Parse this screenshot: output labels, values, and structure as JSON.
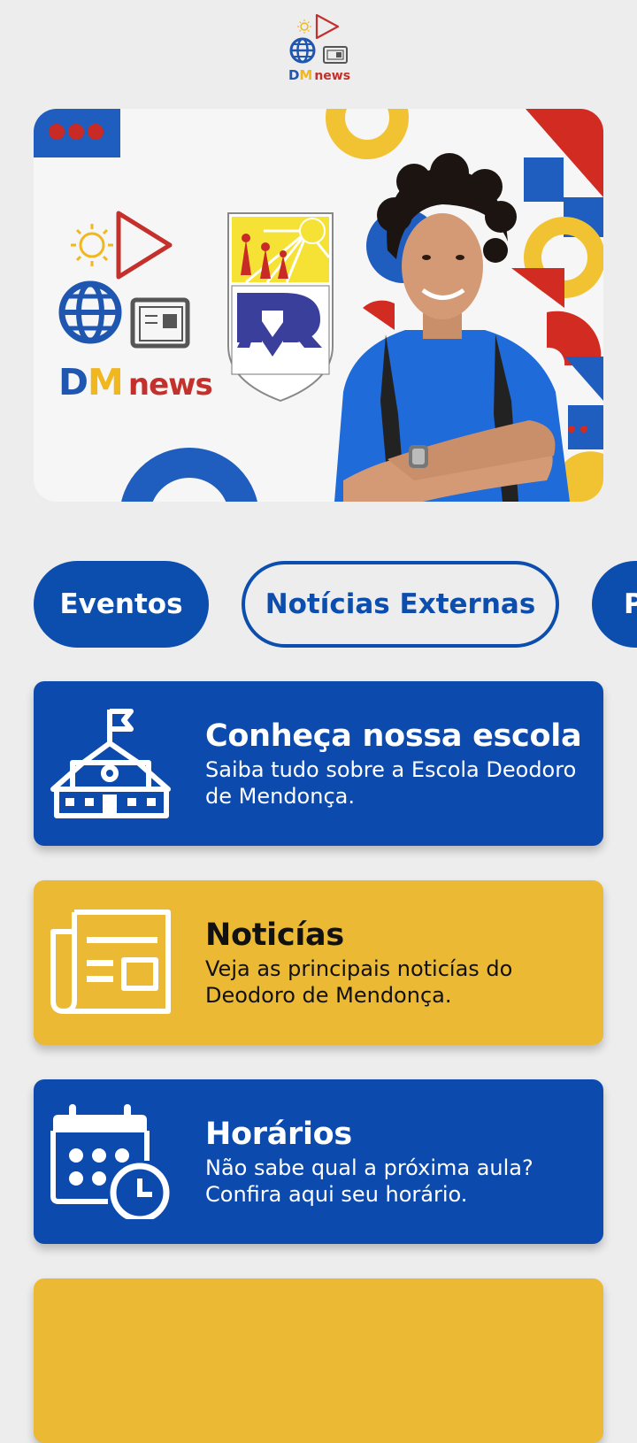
{
  "header": {
    "logo_d": "D",
    "logo_m": "M",
    "logo_news": "news"
  },
  "banner": {
    "logo_d": "D",
    "logo_m": "M",
    "logo_news": "news"
  },
  "tabs": [
    {
      "label": "Eventos"
    },
    {
      "label": "Notícias Externas"
    },
    {
      "label": "P"
    }
  ],
  "cards": [
    {
      "title": "Conheça nossa escola",
      "description": "Saiba tudo sobre a Escola Deodoro de Mendonça.",
      "icon": "school-icon"
    },
    {
      "title": "Noticías",
      "description": "Veja as principais noticías do Deodoro de Mendonça.",
      "icon": "newspaper-icon"
    },
    {
      "title": "Horários",
      "description": "Não sabe qual a próxima aula? Confira aqui seu horário.",
      "icon": "calendar-clock-icon"
    }
  ],
  "colors": {
    "primary_blue": "#0c4aae",
    "accent_yellow": "#ebb934",
    "accent_red": "#c4302b",
    "background": "#ededee"
  }
}
